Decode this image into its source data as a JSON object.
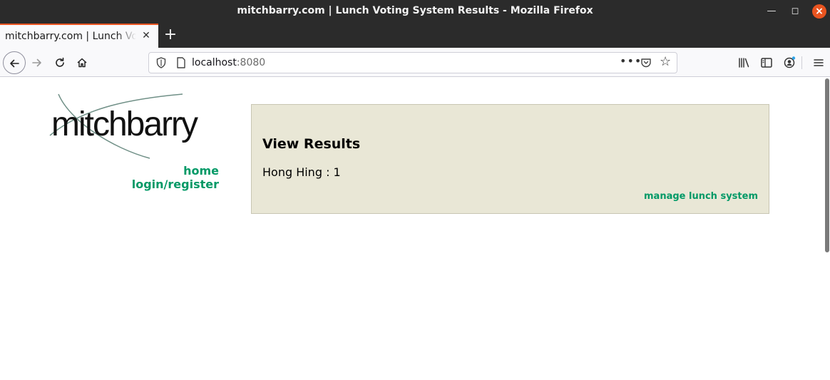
{
  "window": {
    "title": "mitchbarry.com | Lunch Voting System Results - Mozilla Firefox"
  },
  "tabs": [
    {
      "label": "mitchbarry.com | Lunch Voting System Results",
      "active": true
    }
  ],
  "toolbar": {
    "url_host": "localhost",
    "url_port": ":8080"
  },
  "site": {
    "logo_text": "mitchbarry",
    "nav": [
      {
        "label": "home"
      },
      {
        "label": "login/register"
      }
    ]
  },
  "results": {
    "heading": "View Results",
    "entry": "Hong Hing : 1",
    "manage_link": "manage lunch system"
  },
  "colors": {
    "link_green": "#009966",
    "panel_bg": "#e9e7d6",
    "titlebar": "#2b2b2b",
    "accent_orange": "#e95420"
  }
}
